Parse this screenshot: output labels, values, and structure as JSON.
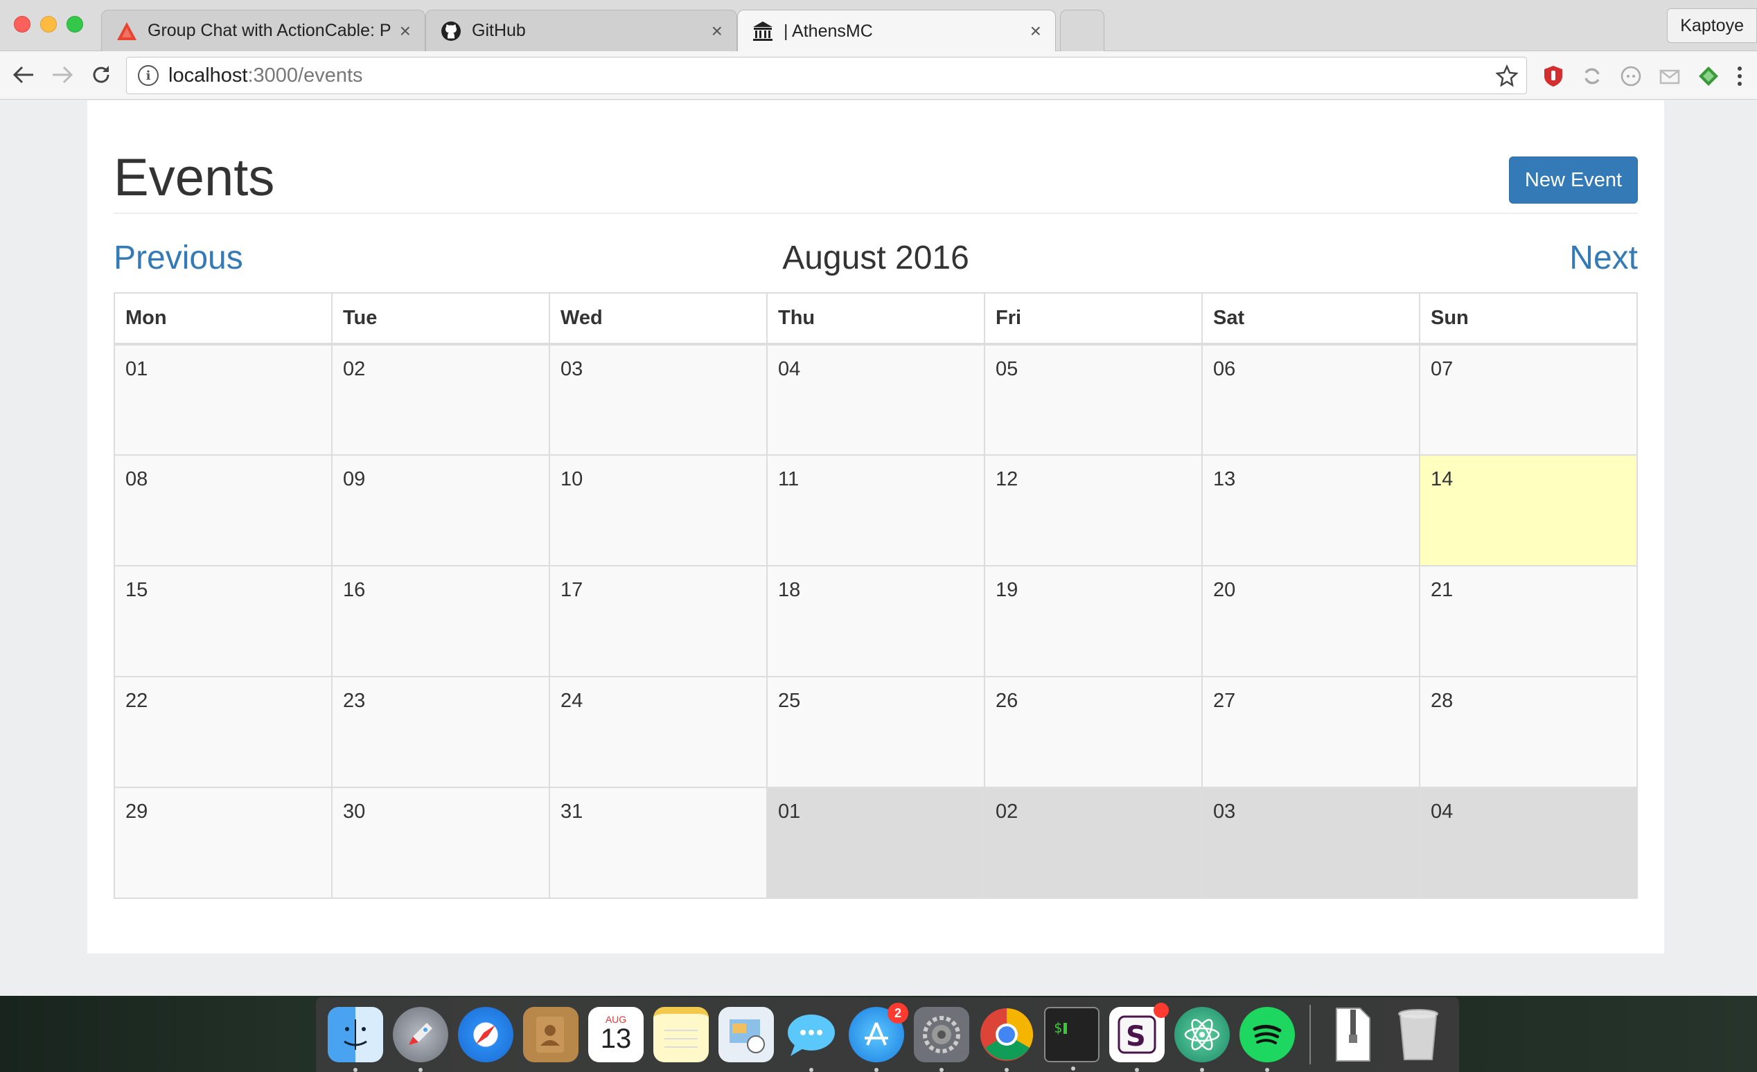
{
  "browser": {
    "tabs": [
      {
        "title": "Group Chat with ActionCable: P",
        "icon": "warning-triangle-icon",
        "close": "×"
      },
      {
        "title": "GitHub",
        "icon": "github-icon",
        "close": "×"
      },
      {
        "title": "| AthensMC",
        "icon": "building-icon",
        "close": "×"
      }
    ],
    "profile_name": "Kaptoye",
    "url_host": "localhost",
    "url_path": ":3000/events"
  },
  "page": {
    "title": "Events",
    "new_event_label": "New Event",
    "prev_label": "Previous",
    "next_label": "Next",
    "month_label": "August 2016"
  },
  "calendar": {
    "weekdays": [
      "Mon",
      "Tue",
      "Wed",
      "Thu",
      "Fri",
      "Sat",
      "Sun"
    ],
    "weeks": [
      [
        "01",
        "02",
        "03",
        "04",
        "05",
        "06",
        "07"
      ],
      [
        "08",
        "09",
        "10",
        "11",
        "12",
        "13",
        "14"
      ],
      [
        "15",
        "16",
        "17",
        "18",
        "19",
        "20",
        "21"
      ],
      [
        "22",
        "23",
        "24",
        "25",
        "26",
        "27",
        "28"
      ],
      [
        "29",
        "30",
        "31",
        "01",
        "02",
        "03",
        "04"
      ]
    ],
    "today": "14",
    "today_color": "#ffffc0",
    "other_month_color": "#dcdcdc",
    "accent_color": "#337ab7"
  },
  "dock": {
    "calendar_month": "AUG",
    "calendar_day": "13",
    "app_store_badge": "2",
    "apps": [
      "finder-icon",
      "launchpad-icon",
      "safari-icon",
      "contacts-icon",
      "calendar-icon",
      "notes-icon",
      "preview-icon",
      "messages-icon",
      "app-store-icon",
      "system-preferences-icon",
      "chrome-icon",
      "terminal-icon",
      "slack-icon",
      "atom-icon",
      "spotify-icon",
      "zip-file-icon",
      "trash-icon"
    ]
  }
}
